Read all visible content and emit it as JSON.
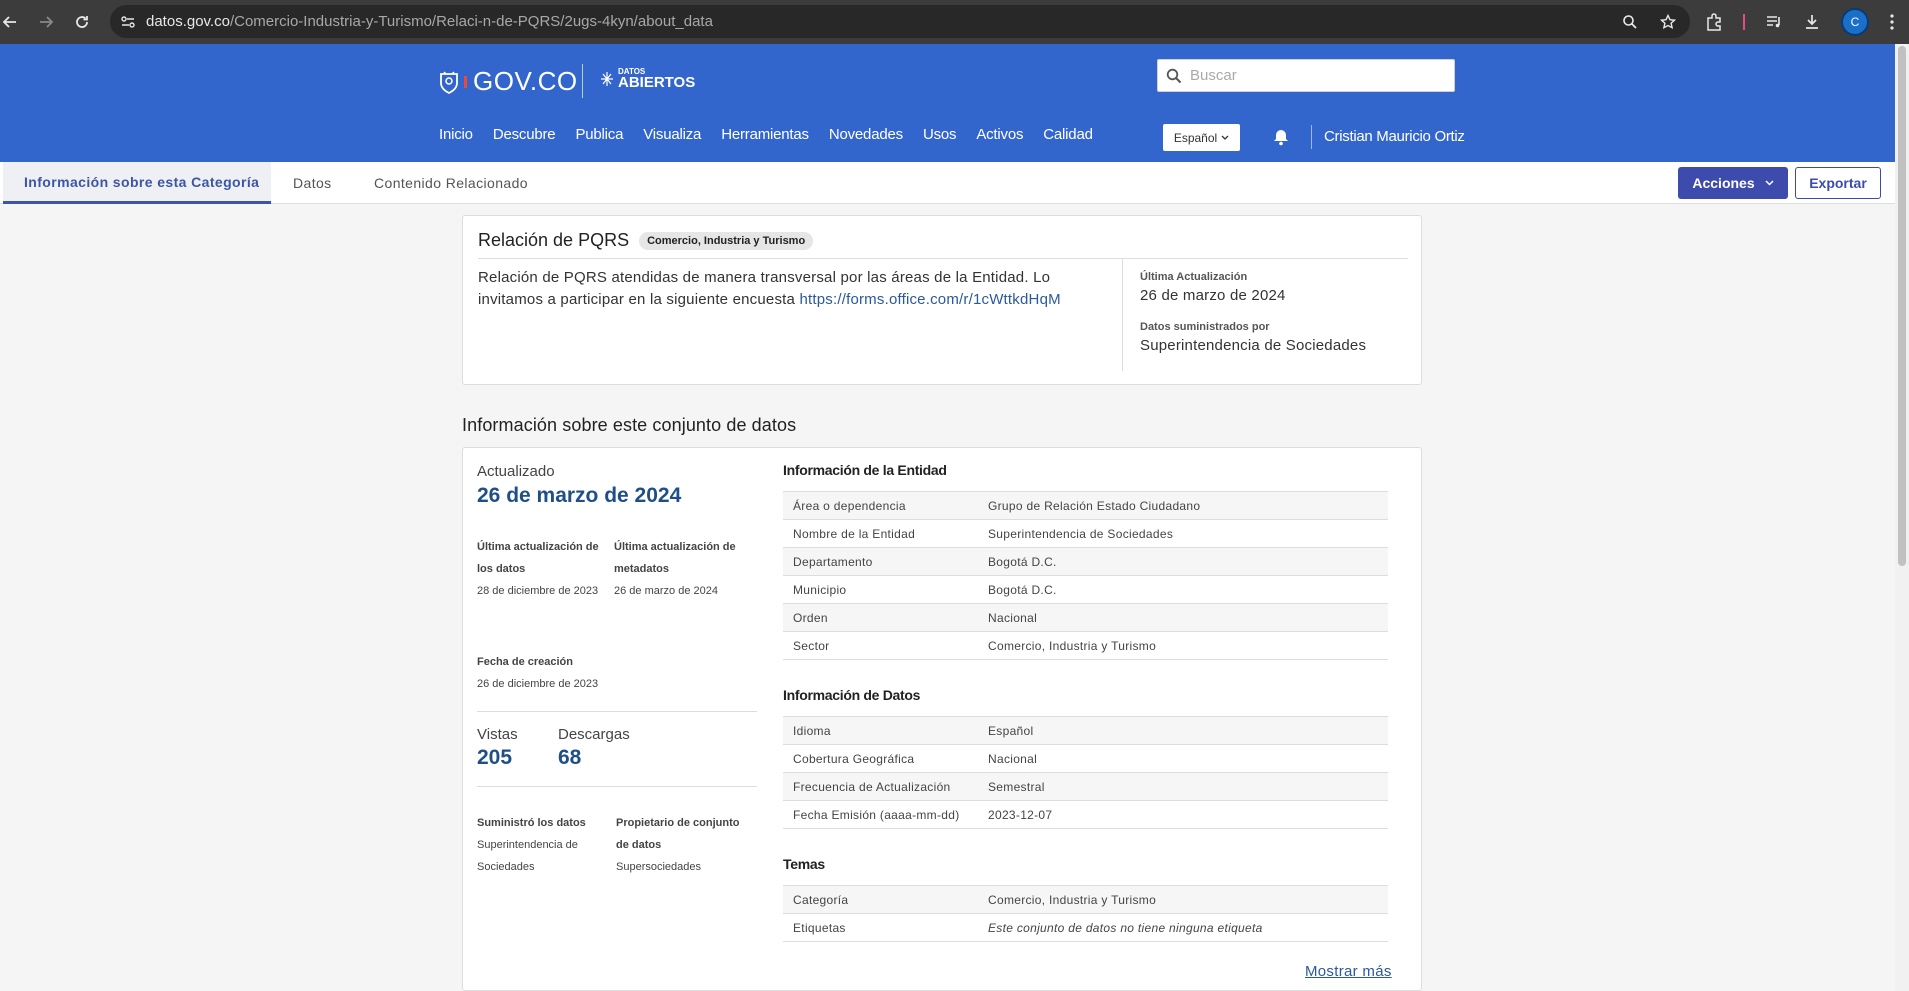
{
  "browser": {
    "url_domain": "datos.gov.co",
    "url_path": "/Comercio-Industria-y-Turismo/Relaci-n-de-PQRS/2ugs-4kyn/about_data",
    "profile_initial": "C"
  },
  "header": {
    "gov_logo_text": "GOV.CO",
    "datos_small": "DATOS",
    "datos_big": "ABIERTOS",
    "search_placeholder": "Buscar",
    "nav": [
      "Inicio",
      "Descubre",
      "Publica",
      "Visualiza",
      "Herramientas",
      "Novedades",
      "Usos",
      "Activos",
      "Calidad"
    ],
    "language": "Español",
    "user_name": "Cristian Mauricio Ortiz"
  },
  "tabs": {
    "items": [
      "Información sobre esta Categoría",
      "Datos",
      "Contenido Relacionado"
    ],
    "active_index": 0,
    "acciones_label": "Acciones",
    "exportar_label": "Exportar"
  },
  "summary": {
    "title": "Relación de PQRS",
    "category_badge": "Comercio, Industria y Turismo",
    "description_text": "Relación de PQRS atendidas de manera transversal por las áreas de la Entidad. Lo invitamos a participar en la siguiente encuesta",
    "description_link": "https://forms.office.com/r/1cWttkdHqM",
    "last_update_label": "Última Actualización",
    "last_update_value": "26 de marzo de 2024",
    "provided_by_label": "Datos suministrados por",
    "provided_by_value": "Superintendencia de Sociedades"
  },
  "dataset_info": {
    "section_title": "Información sobre este conjunto de datos",
    "updated_label": "Actualizado",
    "updated_value": "26 de marzo de 2024",
    "data_update_label": "Última actualización de los datos",
    "data_update_value": "28 de diciembre de 2023",
    "metadata_update_label": "Última actualización de metadatos",
    "metadata_update_value": "26 de marzo de 2024",
    "creation_label": "Fecha de creación",
    "creation_value": "26 de diciembre de 2023",
    "views_label": "Vistas",
    "views_value": "205",
    "downloads_label": "Descargas",
    "downloads_value": "68",
    "supplier_label": "Suministró los datos",
    "supplier_value": "Superintendencia de Sociedades",
    "owner_label": "Propietario de conjunto de datos",
    "owner_value": "Supersociedades"
  },
  "entity_info": {
    "title": "Información de la Entidad",
    "rows": [
      {
        "k": "Área o dependencia",
        "v": "Grupo de Relación Estado Ciudadano"
      },
      {
        "k": "Nombre de la Entidad",
        "v": "Superintendencia de Sociedades"
      },
      {
        "k": "Departamento",
        "v": "Bogotá D.C."
      },
      {
        "k": "Municipio",
        "v": "Bogotá D.C."
      },
      {
        "k": "Orden",
        "v": "Nacional"
      },
      {
        "k": "Sector",
        "v": "Comercio, Industria y Turismo"
      }
    ]
  },
  "data_info": {
    "title": "Información de Datos",
    "rows": [
      {
        "k": "Idioma",
        "v": "Español"
      },
      {
        "k": "Cobertura Geográfica",
        "v": "Nacional"
      },
      {
        "k": "Frecuencia de Actualización",
        "v": "Semestral"
      },
      {
        "k": "Fecha Emisión (aaaa-mm-dd)",
        "v": "2023-12-07"
      }
    ]
  },
  "themes": {
    "title": "Temas",
    "rows": [
      {
        "k": "Categoría",
        "v": "Comercio, Industria y Turismo"
      },
      {
        "k": "Etiquetas",
        "v": "Este conjunto de datos no tiene ninguna etiqueta"
      }
    ]
  },
  "show_more": "Mostrar más",
  "colors": {
    "header_blue": "#3366cc",
    "accent": "#3d4bad",
    "big_number": "#1f4f88"
  }
}
